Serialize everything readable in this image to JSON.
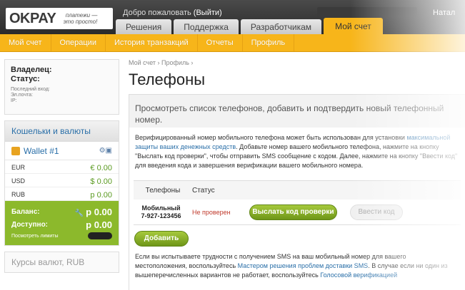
{
  "header": {
    "logo_text": "OKPAY",
    "logo_tagline": "платежи — это просто!",
    "welcome": "Добро пожаловать",
    "logout": "(Выйти)",
    "user_name": "Натал",
    "tabs": [
      "Решения",
      "Поддержка",
      "Разработчикам",
      "Мой счет"
    ],
    "active_tab": "Мой счет"
  },
  "subnav": [
    "Мой счет",
    "Операции",
    "История транзакций",
    "Отчеты",
    "Профиль"
  ],
  "sidebar": {
    "owner_label": "Владелец:",
    "status_label": "Статус:",
    "last_login": "Последний вход:",
    "email": "Эл.почта:",
    "ip": "IP:",
    "wallets_title": "Кошельки и валюты",
    "wallet_name": "Wallet #1",
    "currencies": [
      {
        "code": "EUR",
        "amount": "€ 0.00"
      },
      {
        "code": "USD",
        "amount": "$ 0.00"
      },
      {
        "code": "RUB",
        "amount": "р 0.00"
      }
    ],
    "balance_label": "Баланс:",
    "balance": "р 0.00",
    "available_label": "Доступно:",
    "available": "р 0.00",
    "limits_link": "Посмотреть лимиты",
    "rates_title": "Курсы валют, RUB"
  },
  "main": {
    "breadcrumb": "Мой счет › Профиль ›",
    "title": "Телефоны",
    "intro": "Просмотреть список телефонов, добавить и подтвердить новый телефонный номер.",
    "desc_1": "Верифицированный номер мобильного телефона может быть использован для установки ",
    "desc_link": "максимальной защиты ваших денежных средств",
    "desc_2": ". Добавьте номер вашего мобильного телефона, нажмите на кнопку \"Выслать код проверки\", чтобы отправить SMS сообщение с кодом. Далее, нажмите на кнопку \"Ввести код\" для введения кода и завершения верификации вашего мобильного номера.",
    "table": {
      "col_phones": "Телефоны",
      "col_status": "Статус",
      "phone_type": "Мобильный",
      "phone_number": "7-927-123456",
      "status": "Не проверен",
      "send_code": "Выслать код проверки",
      "enter_code": "Ввести код"
    },
    "add_button": "Добавить",
    "help_1": "Если вы испытываете трудности с получением SMS на ваш мобильный номер для вашего местоположения, воспользуйтесь ",
    "help_link1": "Мастером решения проблем доставки SMS",
    "help_2": ". В случае если ни один из вышеперечисленных вариантов не работает, воспользуйтесь ",
    "help_link2": "Голосовой верификацией"
  },
  "colors": {
    "accent": "#f7b51a",
    "green": "#8cb92c",
    "link": "#2a6fa8"
  }
}
